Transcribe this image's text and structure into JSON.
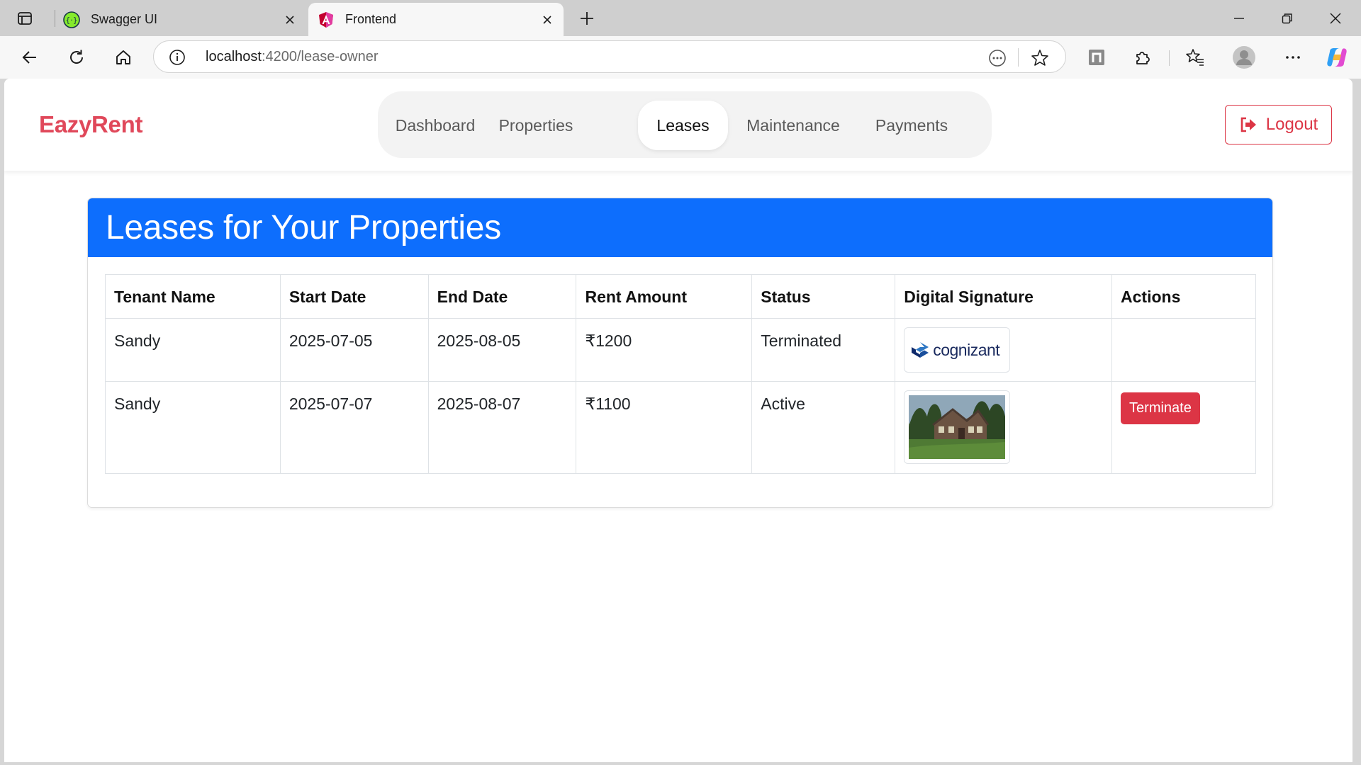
{
  "browser": {
    "tabs": [
      {
        "title": "Swagger UI",
        "active": false
      },
      {
        "title": "Frontend",
        "active": true
      }
    ],
    "url_host": "localhost",
    "url_path": ":4200/lease-owner"
  },
  "app": {
    "brand": "EazyRent",
    "nav": [
      {
        "label": "Dashboard",
        "active": false
      },
      {
        "label": "Properties",
        "active": false
      },
      {
        "label": "Leases",
        "active": true
      },
      {
        "label": "Maintenance",
        "active": false
      },
      {
        "label": "Payments",
        "active": false
      }
    ],
    "logout_label": "Logout",
    "colors": {
      "brand": "#e0485a",
      "primary": "#0d6efd",
      "danger": "#dc3545"
    }
  },
  "leases": {
    "title": "Leases for Your Properties",
    "columns": [
      "Tenant Name",
      "Start Date",
      "End Date",
      "Rent Amount",
      "Status",
      "Digital Signature",
      "Actions"
    ],
    "rows": [
      {
        "tenant": "Sandy",
        "start": "2025-07-05",
        "end": "2025-08-05",
        "rent": "₹1200",
        "status": "Terminated",
        "signature_text": "cognizant",
        "action": ""
      },
      {
        "tenant": "Sandy",
        "start": "2025-07-07",
        "end": "2025-08-07",
        "rent": "₹1100",
        "status": "Active",
        "signature_image": "house-photo",
        "action": "Terminate"
      }
    ]
  }
}
